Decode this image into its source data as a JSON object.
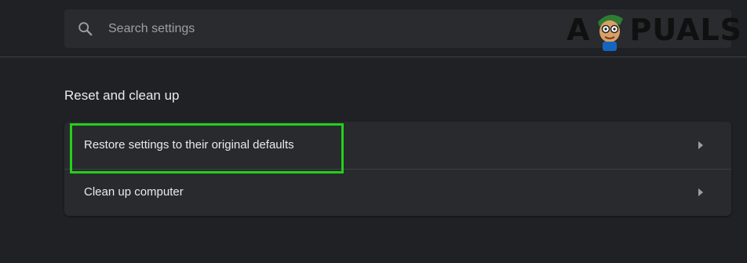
{
  "search": {
    "placeholder": "Search settings"
  },
  "watermark": {
    "text_left": "A",
    "text_right": "PUALS"
  },
  "section": {
    "title": "Reset and clean up"
  },
  "rows": [
    {
      "label": "Restore settings to their original defaults",
      "icon": "arrow-right-icon"
    },
    {
      "label": "Clean up computer",
      "icon": "arrow-right-icon"
    }
  ],
  "colors": {
    "background": "#202124",
    "card": "#292a2d",
    "text": "#e8eaed",
    "placeholder": "#9aa0a6",
    "highlight": "#22d01a"
  }
}
